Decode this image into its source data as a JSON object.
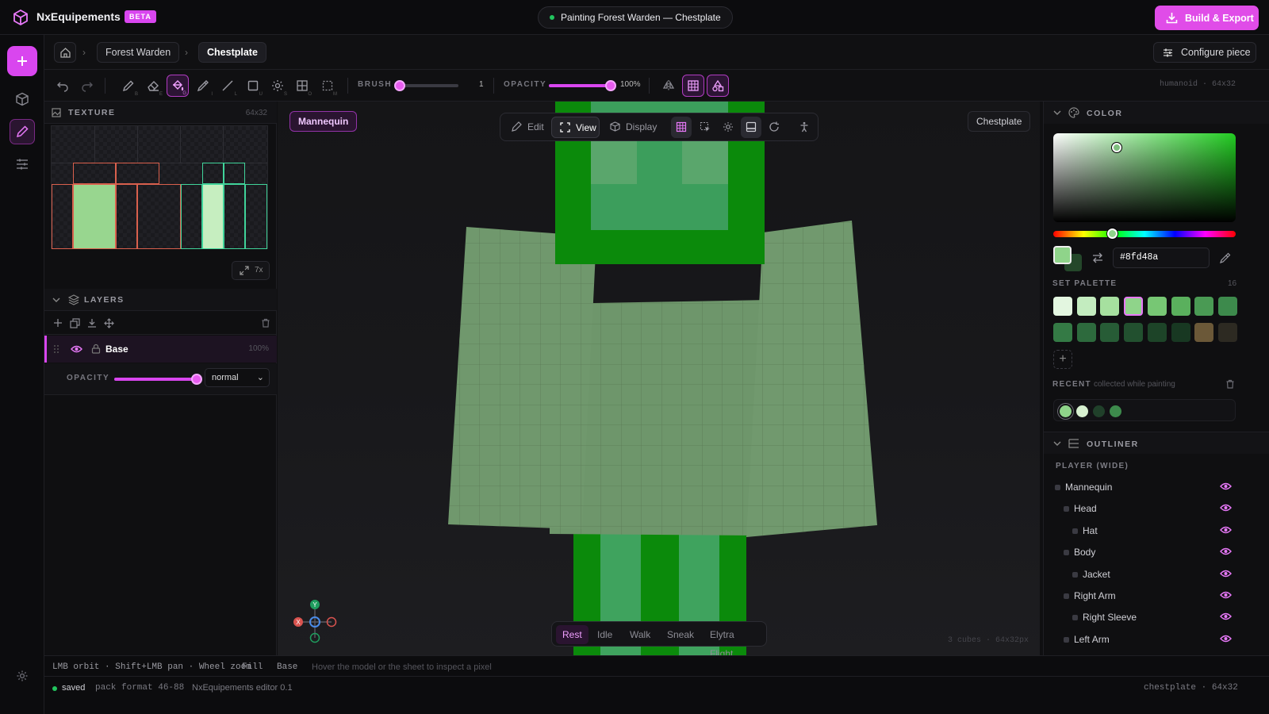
{
  "app": {
    "brand": "NxEquipements",
    "badge": "BETA",
    "status": "Painting Forest Warden — Chestplate",
    "export_label": "Build & Export"
  },
  "breadcrumb": {
    "items": [
      "Forest Warden",
      "Chestplate"
    ]
  },
  "configure_label": "Configure piece",
  "toolbar": {
    "brush_label": "BRUSH",
    "brush_value": "1",
    "opacity_label": "OPACITY",
    "opacity_value": "100%",
    "brush_fraction": 0,
    "opacity_fraction": 1,
    "rig": "humanoid · 64x32",
    "shortcut_keys": [
      "B",
      "E",
      "G",
      "I",
      "L",
      "U",
      "S",
      "O",
      "M"
    ]
  },
  "texture": {
    "title": "TEXTURE",
    "size": "64x32",
    "zoom": "7x"
  },
  "layers": {
    "title": "LAYERS",
    "items": [
      {
        "name": "Base",
        "opacity": "100%"
      }
    ],
    "opacity_label": "OPACITY",
    "opacity_fraction": 1,
    "blend_mode": "normal"
  },
  "viewport": {
    "model_chip": "Mannequin",
    "piece_chip": "Chestplate",
    "modes": [
      "Edit",
      "View",
      "Display"
    ],
    "active_mode": "View",
    "poses": [
      "Rest",
      "Idle",
      "Walk",
      "Sneak",
      "Elytra Flight"
    ],
    "active_pose": "Rest",
    "info": "3 cubes · 64x32px"
  },
  "color": {
    "title": "COLOR",
    "hex": "#8fd48a",
    "primary": "#8fd48a",
    "secondary": "#24472a",
    "palette_label": "SET PALETTE",
    "palette_count": "16",
    "palette": [
      "#e3f6e0",
      "#c3ecbf",
      "#a6e09f",
      "#8fd48a",
      "#77c774",
      "#5ab05d",
      "#4a9a54",
      "#3d8a4c",
      "#347a45",
      "#2d6a3d",
      "#275c36",
      "#22502f",
      "#1d4428",
      "#183822",
      "#6b5838",
      "#2d2a22"
    ],
    "selected_index": 3,
    "recent_label": "RECENT",
    "recent_sub": "collected while painting",
    "recent": [
      "#8fd48a",
      "#d7f0d0",
      "#20402a",
      "#3d8a4c"
    ]
  },
  "outliner": {
    "title": "OUTLINER",
    "group": "PLAYER (WIDE)",
    "items": [
      {
        "name": "Mannequin",
        "depth": 0
      },
      {
        "name": "Head",
        "depth": 1
      },
      {
        "name": "Hat",
        "depth": 2
      },
      {
        "name": "Body",
        "depth": 1
      },
      {
        "name": "Jacket",
        "depth": 2
      },
      {
        "name": "Right Arm",
        "depth": 1
      },
      {
        "name": "Right Sleeve",
        "depth": 2
      },
      {
        "name": "Left Arm",
        "depth": 1
      }
    ]
  },
  "hints": {
    "controls": "LMB orbit · Shift+LMB pan · Wheel zoom",
    "tool": "Fill",
    "layer": "Base",
    "help": "Hover the model or the sheet to inspect a pixel"
  },
  "statusbar": {
    "saved": "saved",
    "pack": "pack format 46-88",
    "version": "NxEquipements editor 0.1",
    "right": "chestplate · 64x32"
  },
  "axes": {
    "x": "X",
    "y": "Y"
  }
}
